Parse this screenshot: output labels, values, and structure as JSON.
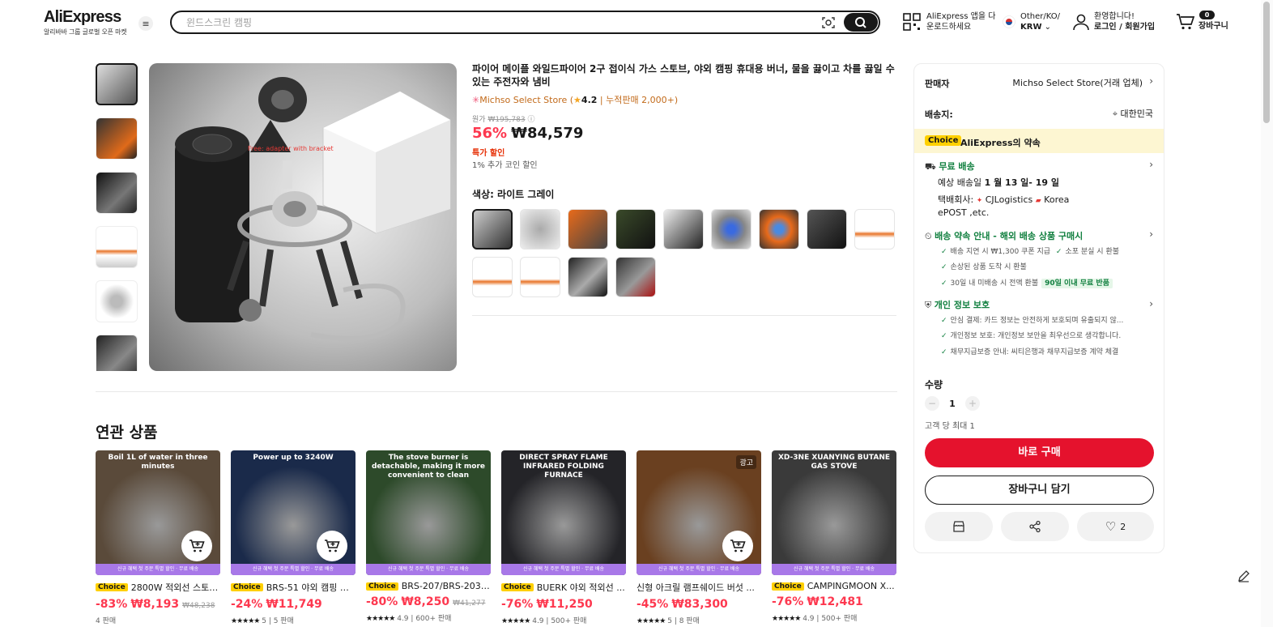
{
  "header": {
    "logo": "AliExpress",
    "logo_sub": "알리바바 그룹 글로벌 오픈 마켓",
    "search_placeholder": "윈드스크린 캠핑",
    "app_line1": "AliExpress 앱을 다",
    "app_line2": "운로드하세요",
    "region_line1": "Other/KO/",
    "region_line2": "KRW",
    "account_line1": "환영합니다!",
    "account_line2": "로그인 / 회원가입",
    "cart_count": "0",
    "cart_label": "장바구니"
  },
  "product": {
    "title": "파이어 메이플 와일드파이어 2구 접이식 가스 스토브, 야외 캠핑 휴대용 버너, 물을 끓이고 차를 끓일 수 있는 주전자와 냄비",
    "store": "Michso Select Store",
    "rating": "4.2",
    "sold": "누적판매 2,000+",
    "orig_label": "원가",
    "orig_price": "₩195,783",
    "discount": "56%",
    "price": "₩84,579",
    "sale_tag": "특가 할인",
    "coin": "1% 추가 코인 할인",
    "color_label": "색상: 라이트 그레이",
    "main_img_text": "Free: adapter with bracket"
  },
  "panel": {
    "seller_label": "판매자",
    "seller_value": "Michso Select Store(거래 업체)",
    "ship_to_label": "배송지:",
    "ship_to_value": "대한민국",
    "choice_tag": "Choice",
    "choice_text": "AliExpress의 약속",
    "free_ship": "무료 배송",
    "delivery_prefix": "예상 배송일",
    "delivery_date": "1 월 13 일- 19 일",
    "carrier_label": "택배회사:",
    "carrier_a": "CJLogistics",
    "carrier_b": "Korea",
    "carrier_c": "ePOST ,etc.",
    "promise_title": "배송 약속 안내 - 해외 배송 상품 구매시",
    "promise_1": "배송 지연 시 ₩1,300 쿠폰 지급",
    "promise_2": "소포 분실 시 환불",
    "promise_3": "손상된 상품 도착 시 환불",
    "promise_4": "30일 내 미배송 시 전액 환불",
    "promise_badge": "90일 이내 무료 반품",
    "privacy_title": "개인 정보 보호",
    "privacy_1": "안심 결제: 카드 정보는 안전하게 보호되며 유출되지 않...",
    "privacy_2": "개인정보 보호: 개인정보 보안을 최우선으로 생각합니다.",
    "privacy_3": "채무지급보증 안내: 씨티은행과 채무지급보증 계약 체결",
    "qty_label": "수량",
    "qty_value": "1",
    "limit": "고객 당 최대 1",
    "buy_now": "바로 구매",
    "add_cart": "장바구니 담기",
    "wish_count": "2"
  },
  "related": {
    "title": "연관 상품",
    "band_text": "신규 혜택 첫 주문 특별 할인 · 무료 배송",
    "items": [
      {
        "headline": "Boil 1L of water in three minutes",
        "choice": "Choice",
        "name": "2800W 적외선 스토브...",
        "discount": "-83%",
        "price": "₩8,193",
        "orig": "₩48,238",
        "rating": "",
        "sold": "4 판매",
        "bg": "#5a4a3a"
      },
      {
        "headline": "Power up to 3240W",
        "choice": "Choice",
        "name": "BRS-51 야외 캠핑 휴...",
        "discount": "-24%",
        "price": "₩11,749",
        "orig": "",
        "rating": "5",
        "sold": "5 판매",
        "bg": "#1a2a4a"
      },
      {
        "headline": "The stove burner is detachable, making it more convenient to clean",
        "choice": "Choice",
        "name": "BRS-207/BRS-203 ...",
        "discount": "-80%",
        "price": "₩8,250",
        "orig": "₩41,277",
        "rating": "4.9",
        "sold": "600+ 판매",
        "bg": "#2d4a2a"
      },
      {
        "headline": "DIRECT SPRAY FLAME INFRARED FOLDING FURNACE",
        "choice": "Choice",
        "name": "BUERK 야외 적외선 ...",
        "discount": "-76%",
        "price": "₩11,250",
        "orig": "",
        "rating": "4.9",
        "sold": "500+ 판매",
        "bg": "#242428"
      },
      {
        "headline": "",
        "choice": "",
        "name": "신형 아크릴 램프쉐이드 버섯 ...",
        "discount": "-45%",
        "price": "₩83,300",
        "orig": "",
        "rating": "5",
        "sold": "8 판매",
        "bg": "#6a4020",
        "ad": "광고"
      },
      {
        "headline": "XD-3NE XUANYING BUTANE GAS STOVE",
        "choice": "Choice",
        "name": "CAMPINGMOON X...",
        "discount": "-76%",
        "price": "₩12,481",
        "orig": "",
        "rating": "4.9",
        "sold": "500+ 판매",
        "bg": "#3a3a3a"
      }
    ]
  }
}
